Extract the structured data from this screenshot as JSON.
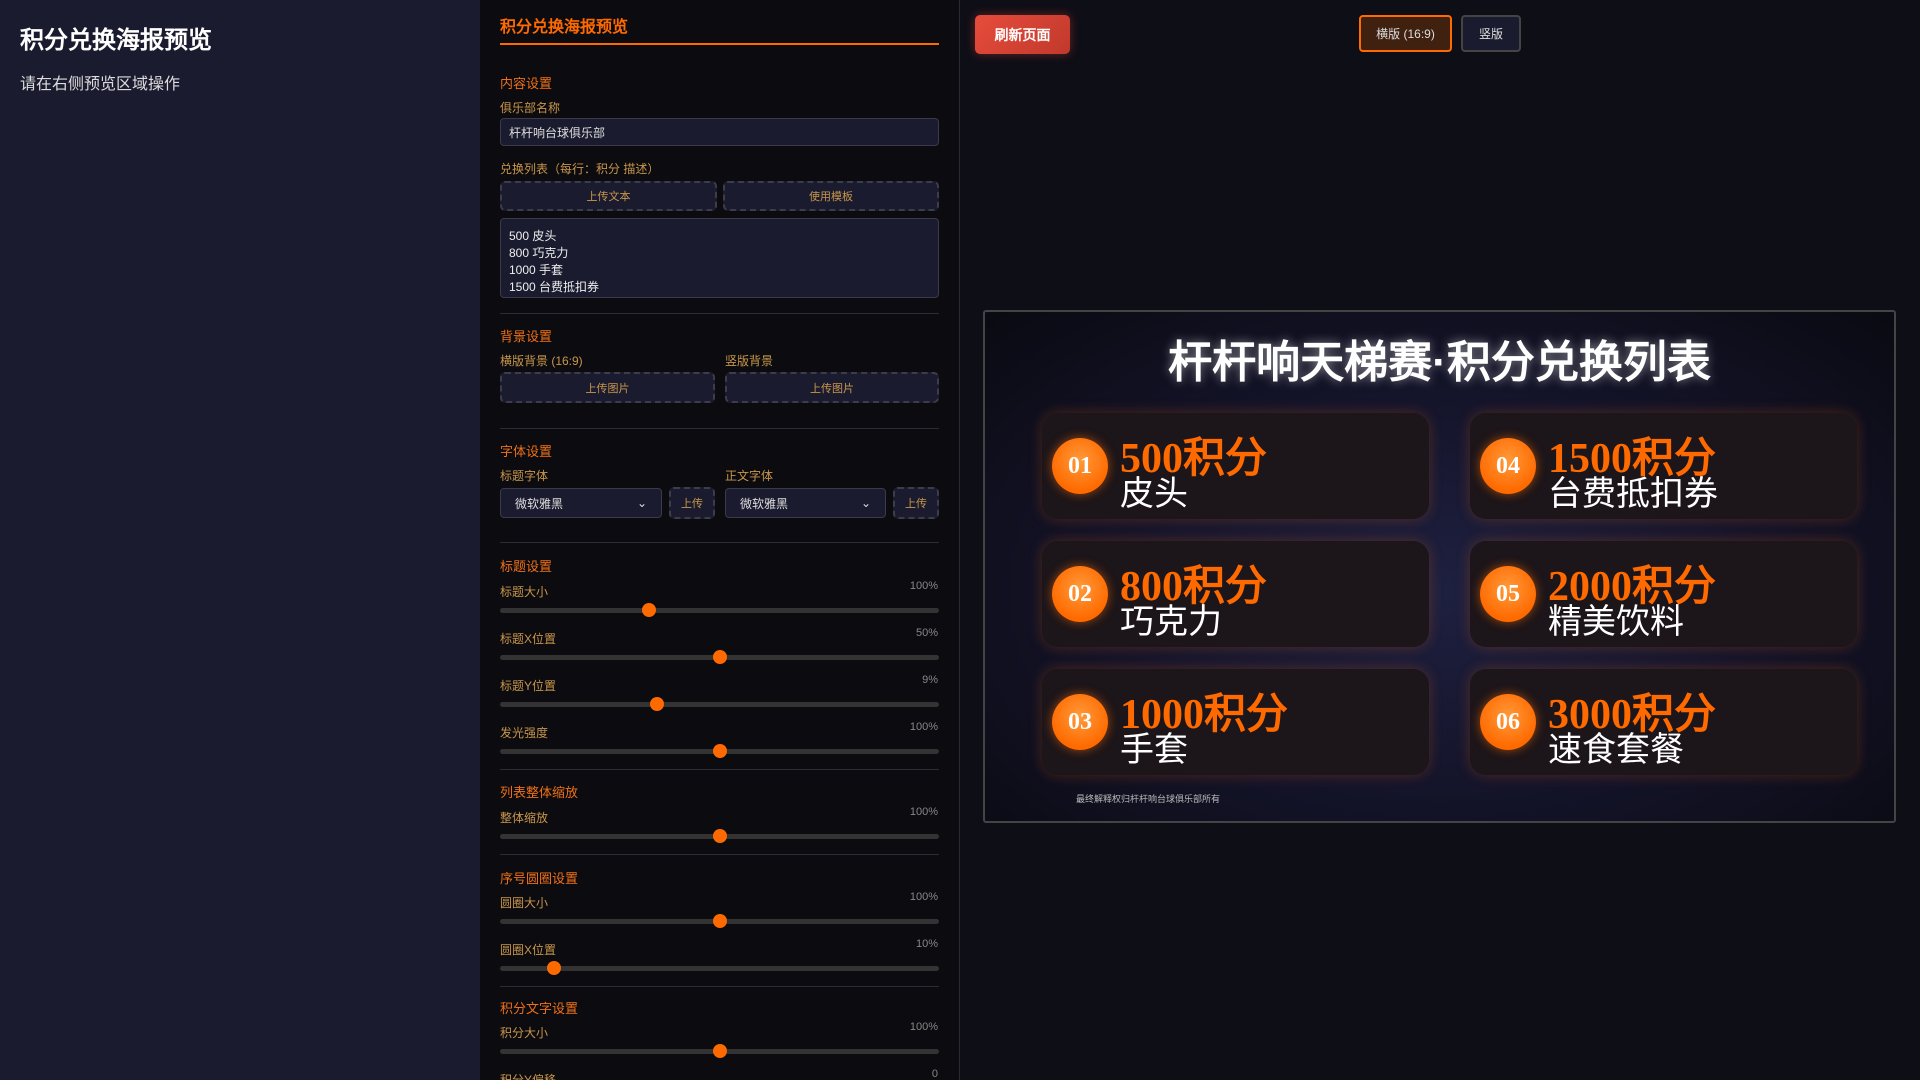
{
  "left": {
    "title": "积分兑换海报预览",
    "hint": "请在右侧预览区域操作"
  },
  "panel": {
    "title": "积分兑换海报预览",
    "content": {
      "heading": "内容设置",
      "club_label": "俱乐部名称",
      "club_value": "杆杆响台球俱乐部",
      "list_label": "兑换列表（每行：积分 描述）",
      "upload_text": "上传文本",
      "use_template": "使用模板",
      "list_value": "500 皮头\n800 巧克力\n1000 手套\n1500 台费抵扣券"
    },
    "background": {
      "heading": "背景设置",
      "landscape_label": "横版背景 (16:9)",
      "portrait_label": "竖版背景",
      "upload_image": "上传图片"
    },
    "font": {
      "heading": "字体设置",
      "title_font_label": "标题字体",
      "body_font_label": "正文字体",
      "title_font_value": "微软雅黑",
      "body_font_value": "微软雅黑",
      "upload": "上传"
    },
    "title_settings": {
      "heading": "标题设置"
    },
    "list_scale": {
      "heading": "列表整体缩放"
    },
    "circle_settings": {
      "heading": "序号圆圈设置"
    },
    "points_settings": {
      "heading": "积分文字设置"
    },
    "sliders": [
      {
        "label": "标题大小",
        "value": "100%",
        "position": 0.34
      },
      {
        "label": "标题X位置",
        "value": "50%",
        "position": 0.5
      },
      {
        "label": "标题Y位置",
        "value": "9%",
        "position": 0.357
      },
      {
        "label": "发光强度",
        "value": "100%",
        "position": 0.5
      },
      {
        "label": "整体缩放",
        "value": "100%",
        "position": 0.5
      },
      {
        "label": "圆圈大小",
        "value": "100%",
        "position": 0.5
      },
      {
        "label": "圆圈X位置",
        "value": "10%",
        "position": 0.123
      },
      {
        "label": "积分大小",
        "value": "100%",
        "position": 0.5
      },
      {
        "label": "积分Y偏移",
        "value": "0",
        "position": 0.5
      }
    ]
  },
  "toolbar": {
    "refresh": "刷新页面",
    "landscape": "横版 (16:9)",
    "portrait": "竖版"
  },
  "poster": {
    "title": "杆杆响天梯赛·积分兑换列表",
    "items": [
      {
        "num": "01",
        "points": "500积分",
        "desc": "皮头"
      },
      {
        "num": "02",
        "points": "800积分",
        "desc": "巧克力"
      },
      {
        "num": "03",
        "points": "1000积分",
        "desc": "手套"
      },
      {
        "num": "04",
        "points": "1500积分",
        "desc": "台费抵扣券"
      },
      {
        "num": "05",
        "points": "2000积分",
        "desc": "精美饮料"
      },
      {
        "num": "06",
        "points": "3000积分",
        "desc": "速食套餐"
      }
    ],
    "footer": "最终解释权归杆杆响台球俱乐部所有"
  },
  "colors": {
    "accent": "#ff6a00",
    "refresh": "#e74c3c"
  }
}
